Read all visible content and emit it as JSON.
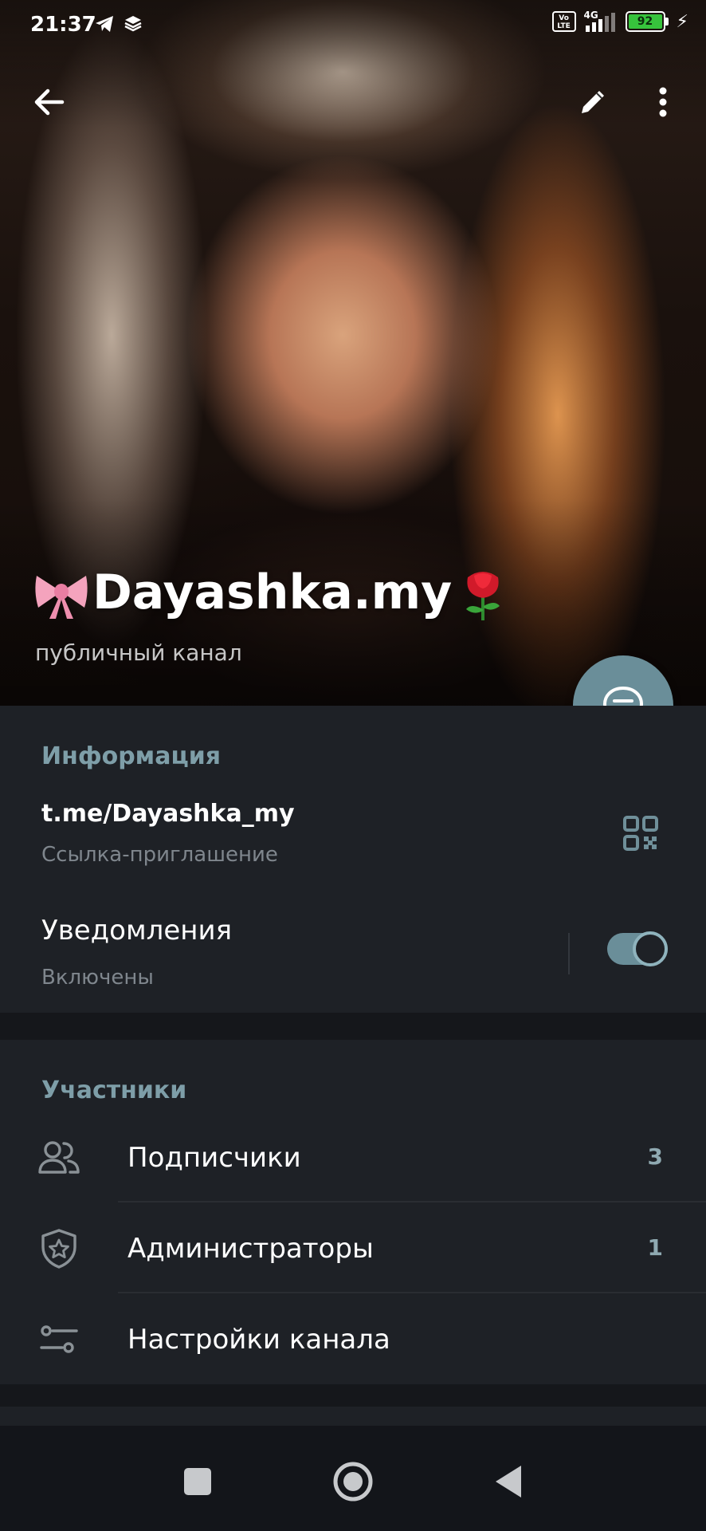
{
  "status_bar": {
    "time": "21:37",
    "left_icons": [
      "telegram-icon",
      "layers-icon"
    ],
    "volte": "Vo LTE",
    "network": "4G",
    "battery": "92",
    "charging_icon": "bolt-icon"
  },
  "header": {
    "back_icon": "arrow-left-icon",
    "edit_icon": "pencil-icon",
    "more_icon": "more-vertical-icon",
    "channel_name": "Dayashka.my",
    "channel_name_prefix_emoji": "ribbon-emoji",
    "channel_name_suffix_emoji": "rose-emoji",
    "channel_type": "публичный канал",
    "fab_icon": "chat-bubble-icon"
  },
  "info": {
    "title": "Информация",
    "link": "t.me/Dayashka_my",
    "link_caption": "Ссылка-приглашение",
    "qr_icon": "qr-code-icon",
    "notifications_title": "Уведомления",
    "notifications_status": "Включены",
    "notifications_enabled": true
  },
  "members": {
    "title": "Участники",
    "items": [
      {
        "icon": "users-icon",
        "label": "Подписчики",
        "count": "3"
      },
      {
        "icon": "shield-star-icon",
        "label": "Администраторы",
        "count": "1"
      },
      {
        "icon": "sliders-icon",
        "label": "Настройки канала",
        "count": ""
      }
    ]
  },
  "nav": {
    "recents_icon": "square-icon",
    "home_icon": "circle-icon",
    "back_icon": "triangle-back-icon"
  },
  "colors": {
    "accent": "#6a8e99",
    "section_title": "#7e9ea8",
    "background": "#1e2126",
    "battery_green": "#37c33c"
  }
}
